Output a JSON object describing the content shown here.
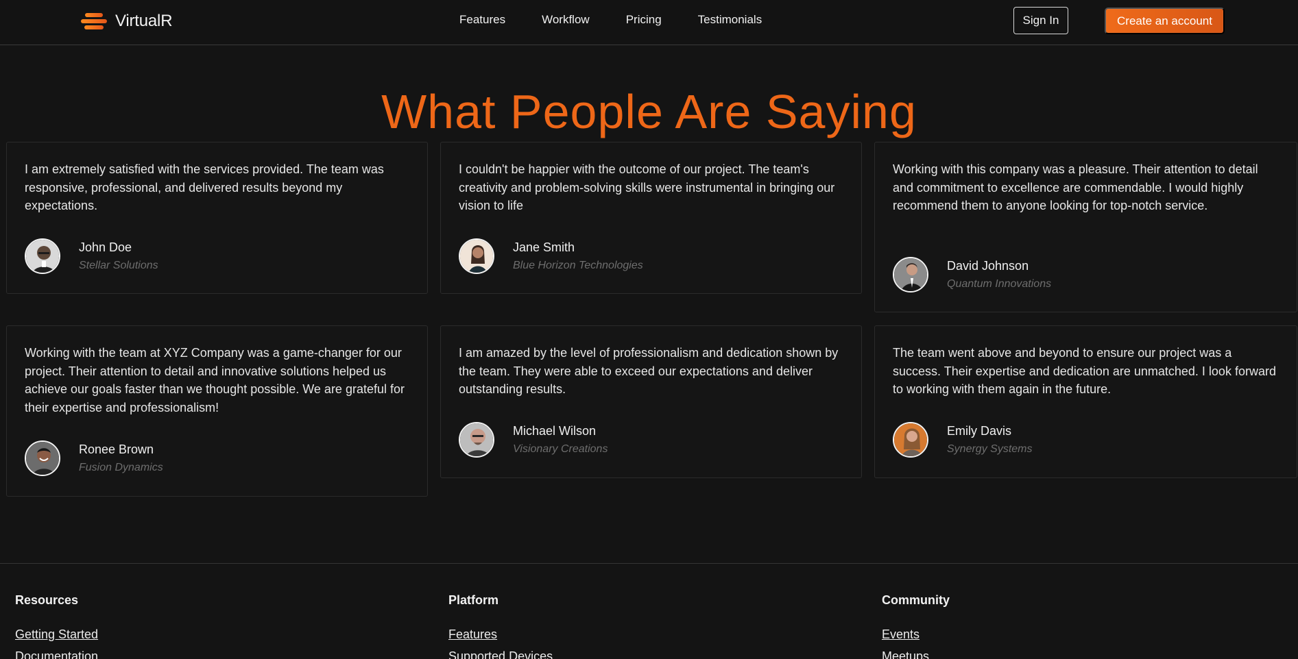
{
  "header": {
    "logo_text": "VirtualR",
    "nav": [
      "Features",
      "Workflow",
      "Pricing",
      "Testimonials"
    ],
    "sign_in": "Sign In",
    "create_account": "Create an account"
  },
  "section": {
    "title": "What People Are Saying"
  },
  "testimonials": [
    {
      "quote": "I am extremely satisfied with the services provided. The team was responsive, professional, and delivered results beyond my expectations.",
      "name": "John Doe",
      "company": "Stellar Solutions"
    },
    {
      "quote": "I couldn't be happier with the outcome of our project. The team's creativity and problem-solving skills were instrumental in bringing our vision to life",
      "name": "Jane Smith",
      "company": "Blue Horizon Technologies"
    },
    {
      "quote": "Working with this company was a pleasure. Their attention to detail and commitment to excellence are commendable. I would highly recommend them to anyone looking for top-notch service.",
      "name": "David Johnson",
      "company": "Quantum Innovations"
    },
    {
      "quote": "Working with the team at XYZ Company was a game-changer for our project. Their attention to detail and innovative solutions helped us achieve our goals faster than we thought possible. We are grateful for their expertise and professionalism!",
      "name": "Ronee Brown",
      "company": "Fusion Dynamics"
    },
    {
      "quote": "I am amazed by the level of professionalism and dedication shown by the team. They were able to exceed our expectations and deliver outstanding results.",
      "name": "Michael Wilson",
      "company": "Visionary Creations"
    },
    {
      "quote": "The team went above and beyond to ensure our project was a success. Their expertise and dedication are unmatched. I look forward to working with them again in the future.",
      "name": "Emily Davis",
      "company": "Synergy Systems"
    }
  ],
  "footer": {
    "columns": [
      {
        "heading": "Resources",
        "links": [
          "Getting Started",
          "Documentation"
        ]
      },
      {
        "heading": "Platform",
        "links": [
          "Features",
          "Supported Devices"
        ]
      },
      {
        "heading": "Community",
        "links": [
          "Events",
          "Meetups"
        ]
      }
    ]
  },
  "colors": {
    "accent": "#ee6718",
    "background": "#141414",
    "card_border": "#2b2b2b"
  }
}
